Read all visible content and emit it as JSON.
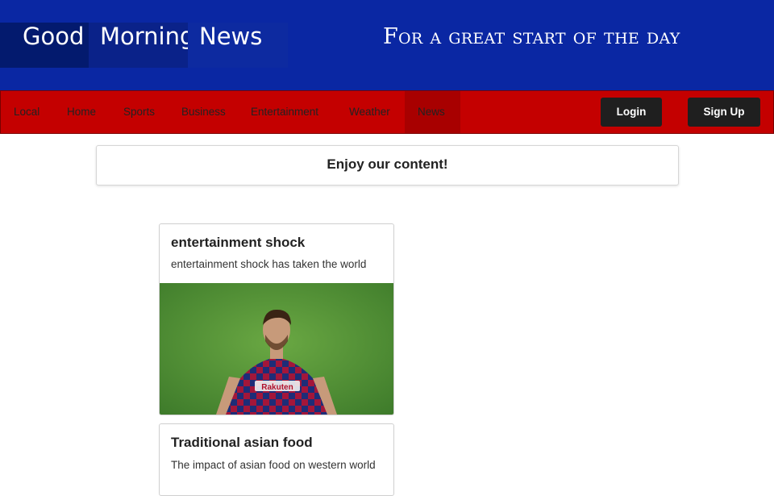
{
  "header": {
    "logo_words": [
      "Good",
      "Morning",
      "News"
    ],
    "tagline": "For a great start of the day"
  },
  "nav": {
    "items": [
      {
        "label": "Local"
      },
      {
        "label": "Home"
      },
      {
        "label": "Sports"
      },
      {
        "label": "Business"
      },
      {
        "label": "Entertainment"
      },
      {
        "label": "Weather"
      },
      {
        "label": "News"
      }
    ],
    "login_label": "Login",
    "signup_label": "Sign Up"
  },
  "banner": {
    "text": "Enjoy our content!"
  },
  "articles": [
    {
      "title": "entertainment shock",
      "description": "entertainment shock has taken the world",
      "image_subject": "soccer player in striped jersey on green pitch"
    },
    {
      "title": "Traditional asian food",
      "description": "The impact of asian food on western world"
    }
  ],
  "colors": {
    "header_bg": "#0a27a3",
    "nav_bg": "#c40000",
    "button_bg": "#1f1f1f"
  }
}
